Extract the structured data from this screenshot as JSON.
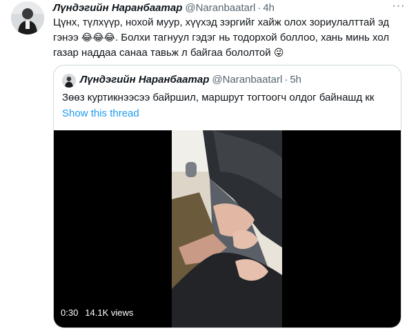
{
  "tweet": {
    "author_name": "Лүндэгийн Наранбаатар",
    "handle": "@Naranbaatarl",
    "separator": "·",
    "time": "4h",
    "text_line1": "Цүнх, түлхүүр, нохой муур, хүүхэд зэргийг хайж олох зориулалттай эд",
    "text_line2_start": "гэнээ",
    "emojis": "😂😂😂",
    "text_line2_end": ". Болхи тагнуул гэдэг нь тодорхой боллоо, хань минь хол",
    "text_line3": "газар наддаа санаа тавьж л байгаа бололтой",
    "text_line3_emoji": "😜",
    "more_icon": "more-icon"
  },
  "quote": {
    "author_name": "Лүндэгийн Наранбаатар",
    "handle": "@Naranbaatarl",
    "separator": "·",
    "time": "5h",
    "text": "Зөөз куртикнээсээ байршил, маршрут тогтоогч олдог байнашд кк",
    "show_thread": "Show this thread",
    "video": {
      "duration": "0:30",
      "views": "14.1K views"
    }
  },
  "colors": {
    "link": "#1d9bf0",
    "secondary_text": "#536471",
    "border": "#cfd9de"
  }
}
